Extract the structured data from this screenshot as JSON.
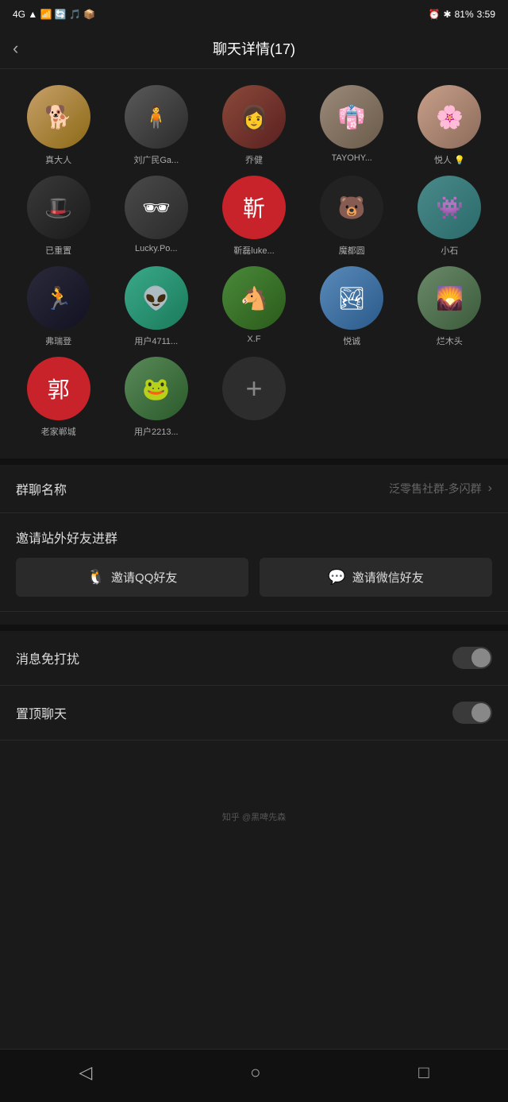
{
  "statusBar": {
    "left": "4G  ▲",
    "time": "3:59",
    "battery": "81%"
  },
  "header": {
    "title": "聊天详情(17)",
    "backLabel": "‹"
  },
  "members": [
    {
      "id": 1,
      "name": "真大人",
      "avatarClass": "av-dog",
      "emoji": "🐕"
    },
    {
      "id": 2,
      "name": "刘广民Ga...",
      "avatarClass": "av-man1",
      "emoji": "🧍"
    },
    {
      "id": 3,
      "name": "乔健",
      "avatarClass": "av-girl1",
      "emoji": "👩"
    },
    {
      "id": 4,
      "name": "TAYOHY...",
      "avatarClass": "av-lady1",
      "emoji": "👘"
    },
    {
      "id": 5,
      "name": "悦人 💡",
      "avatarClass": "av-vintage",
      "emoji": "🌸"
    },
    {
      "id": 6,
      "name": "已重置",
      "avatarClass": "av-hat",
      "emoji": "🎩"
    },
    {
      "id": 7,
      "name": "Lucky.Po...",
      "avatarClass": "av-bw",
      "emoji": "🕶"
    },
    {
      "id": 8,
      "name": "靳磊luke...",
      "avatarClass": "av-red",
      "emoji": "靳"
    },
    {
      "id": 9,
      "name": "魔都圆",
      "avatarClass": "av-bear",
      "emoji": "🐻"
    },
    {
      "id": 10,
      "name": "小石",
      "avatarClass": "av-monster",
      "emoji": "👾"
    },
    {
      "id": 11,
      "name": "弗瑞登",
      "avatarClass": "av-run",
      "emoji": "🏃"
    },
    {
      "id": 12,
      "name": "用户4711...",
      "avatarClass": "av-teal-monster",
      "emoji": "👽"
    },
    {
      "id": 13,
      "name": "X.F",
      "avatarClass": "av-horse",
      "emoji": "🐴"
    },
    {
      "id": 14,
      "name": "悦诚",
      "avatarClass": "av-field",
      "emoji": "🏞"
    },
    {
      "id": 15,
      "name": "烂木头",
      "avatarClass": "av-outdoor",
      "emoji": "🌄"
    },
    {
      "id": 16,
      "name": "老家郸城",
      "avatarClass": "av-郭",
      "emoji": "郭"
    },
    {
      "id": 17,
      "name": "用户2213...",
      "avatarClass": "av-frog",
      "emoji": "🐸"
    }
  ],
  "addButtonLabel": "+",
  "groupName": {
    "label": "群聊名称",
    "value": "泛零售社群-多闪群"
  },
  "inviteSection": {
    "label": "邀请站外好友进群",
    "qqButton": "邀请QQ好友",
    "wechatButton": "邀请微信好友"
  },
  "toggleRows": [
    {
      "label": "消息免打扰"
    },
    {
      "label": "置顶聊天"
    }
  ],
  "bottomNav": [
    {
      "label": "◁",
      "name": "back"
    },
    {
      "label": "○",
      "name": "home"
    },
    {
      "label": "□",
      "name": "recent"
    }
  ],
  "watermark": "知乎 @黑啤先森"
}
